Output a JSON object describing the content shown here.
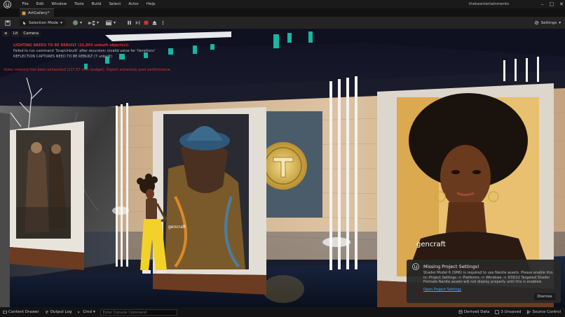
{
  "menubar": {
    "items": [
      "File",
      "Edit",
      "Window",
      "Tools",
      "Build",
      "Select",
      "Actor",
      "Help"
    ],
    "project": "thetaentertainments"
  },
  "tab": {
    "label": "ArtGallery*"
  },
  "toolbar": {
    "selection_mode": "Selection Mode",
    "settings": "Settings"
  },
  "viewport": {
    "mode_label": "Lit",
    "camera_label": "Camera",
    "messages": {
      "lighting": "LIGHTING NEEDS TO BE REBUILT (15,803 unbuilt object(s))",
      "snap": "Failed to run command 'SnapUnbuilt' after recursion: invalid value for 'iterations'",
      "reflection": "REFLECTION CAPTURES NEED TO BE REBUILT (7 unbuilt)",
      "memory": "Video memory has been exhausted (127.87 over budget). Expect extremely poor performance."
    },
    "watermark_a": "gencraft",
    "watermark_b": "gencraft"
  },
  "notice": {
    "title": "Missing Project Settings!",
    "body": "Shader Model 6 (SM6) is required to use Nanite assets. Please enable this in: Project Settings -> Platforms -> Windows -> D3D12 Targeted Shader Formats Nanite assets will not display properly until this is enabled.",
    "link": "Open Project Settings",
    "dismiss": "Dismiss"
  },
  "statusbar": {
    "content_drawer": "Content Drawer",
    "output_log": "Output Log",
    "cmd": "Cmd",
    "console_placeholder": "Enter Console Command",
    "derived_data": "Derived Data",
    "unsaved": "3 Unsaved",
    "source_control": "Source Control"
  },
  "colors": {
    "accent_blue": "#4ea0ff",
    "error_red": "#e23030",
    "stop_red": "#d9302a"
  }
}
